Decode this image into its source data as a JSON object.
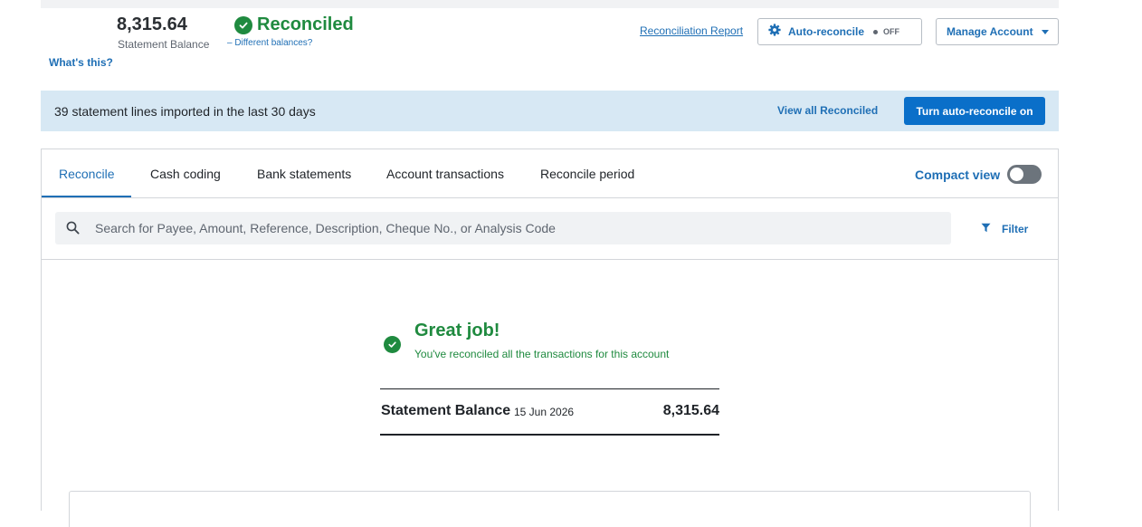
{
  "header": {
    "statement_balance": "8,315.64",
    "statement_balance_label": "Statement Balance",
    "whats_this": "What's this?",
    "status": "Reconciled",
    "different_balances": "– Different balances?",
    "reconciliation_report": "Reconciliation Report",
    "auto_reconcile_label": "Auto-reconcile",
    "auto_reconcile_state": "OFF",
    "manage_account_label": "Manage Account"
  },
  "banner": {
    "message": "39 statement lines imported in the last 30 days",
    "view_all_reconciled": "View all Reconciled",
    "turn_on_button": "Turn auto-reconcile on"
  },
  "tabs": [
    {
      "label": "Reconcile",
      "active": true
    },
    {
      "label": "Cash coding",
      "active": false
    },
    {
      "label": "Bank statements",
      "active": false
    },
    {
      "label": "Account transactions",
      "active": false
    },
    {
      "label": "Reconcile period",
      "active": false
    }
  ],
  "compact_view": {
    "label": "Compact view",
    "enabled": false
  },
  "search": {
    "placeholder": "Search for Payee, Amount, Reference, Description, Cheque No., or Analysis Code",
    "value": ""
  },
  "filter_label": "Filter",
  "success": {
    "title": "Great job!",
    "subtitle": "You've reconciled all the transactions for this account"
  },
  "statement_summary": {
    "label": "Statement Balance",
    "date": "15 Jun 2026",
    "amount": "8,315.64"
  },
  "colors": {
    "accent_blue": "#1f6fb5",
    "button_blue": "#0a6fc9",
    "success_green": "#1f8a3f",
    "banner_bg": "#d7e8f4"
  },
  "icons": [
    "check-circle-icon",
    "gear-icon",
    "chevron-down-icon",
    "search-icon",
    "filter-icon"
  ]
}
